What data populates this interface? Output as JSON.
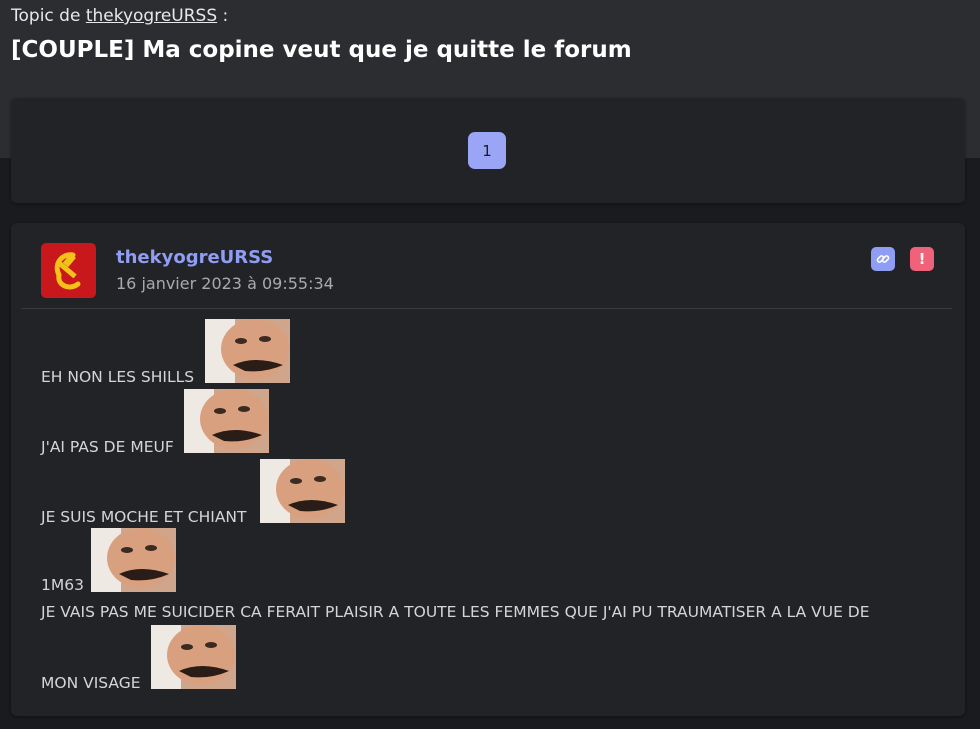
{
  "topic": {
    "prefix": "Topic de",
    "author_link": "thekyogreURSS",
    "suffix": ":",
    "title": "[COUPLE] Ma copine veut que je quitte le forum"
  },
  "pagination": {
    "current_page": "1"
  },
  "post": {
    "author": "thekyogreURSS",
    "date": "16 janvier 2023 à 09:55:34",
    "avatar_icon": "hammer-sickle-icon",
    "actions": {
      "link_icon": "link-icon",
      "report_icon": "report-icon",
      "report_glyph": "!"
    },
    "lines": [
      "EH NON LES SHILLS",
      "J'AI PAS DE MEUF",
      "JE SUIS MOCHE ET CHIANT",
      "1M63",
      "JE VAIS PAS ME SUICIDER CA FERAIT PLAISIR A TOUTE LES FEMMES QUE J'AI PU TRAUMATISER A LA VUE DE",
      "MON VISAGE"
    ]
  },
  "colors": {
    "accent": "#9aa6f5",
    "author": "#8f9ef2",
    "report": "#f0627a",
    "background": "#1a1b1e",
    "card": "#222326"
  }
}
